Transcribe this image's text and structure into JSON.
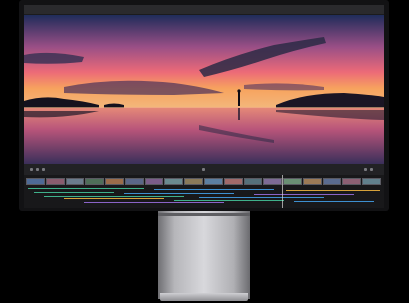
{
  "window": {
    "title": "",
    "left_label": "",
    "right_label": ""
  },
  "viewer": {
    "sky_top": "#2a3a6b",
    "sky_mid": "#e0607a",
    "horizon": "#f5a360",
    "water": "#c25a70"
  },
  "controls": {
    "timecode": ""
  },
  "timeline": {
    "clip_colors": [
      "#4e6a96",
      "#8a5c6e",
      "#6b7c8d",
      "#4f6e59",
      "#9b6c4a",
      "#5a6688",
      "#7b5d8a",
      "#6a8a90",
      "#8a7a5a",
      "#5c7fa1",
      "#a06a6a",
      "#55707a",
      "#7d6b95",
      "#6a8f74",
      "#9c7a56",
      "#5a6b8f",
      "#8c6073",
      "#61808c"
    ],
    "track_colors": [
      "#3fb08a",
      "#3d8fcf",
      "#d6a13a",
      "#3fb08a",
      "#3d8fcf",
      "#8a63c8"
    ]
  },
  "device": {
    "stand_color": "#c9c9cd"
  }
}
